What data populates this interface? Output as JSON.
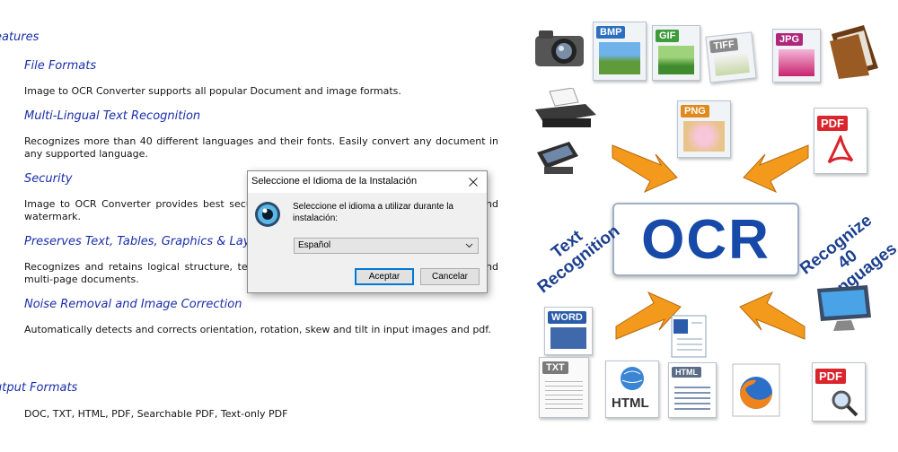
{
  "content": {
    "features_heading": "eatures",
    "sections": [
      {
        "title": "File Formats",
        "text": "Image to OCR Converter supports all popular Document and image formats."
      },
      {
        "title": "Multi-Lingual Text Recognition",
        "text": "Recognizes more than 40 different languages and their fonts. Easily convert any document in any supported language."
      },
      {
        "title": "Security",
        "text": "Image to OCR Converter provides best security features, including password protection and watermark."
      },
      {
        "title": "Preserves Text, Tables, Graphics & Layout",
        "text": "Recognizes and retains logical structure, text formatting, tables, and graphics in single and multi-page documents."
      },
      {
        "title": "Noise Removal and Image Correction",
        "text": "Automatically detects and corrects orientation, rotation, skew and tilt in input images and pdf."
      }
    ],
    "output_heading": "utput Formats",
    "output_text": "DOC, TXT, HTML, PDF, Searchable PDF, Text-only PDF"
  },
  "collage": {
    "center_text": "OCR",
    "left_label": "Text Recognition",
    "right_label": "Recognize 40 Languages",
    "tiles": {
      "bmp": "BMP",
      "gif": "GIF",
      "tiff": "TIFF",
      "jpg": "JPG",
      "png": "PNG",
      "pdf": "PDF",
      "word": "WORD",
      "txt": "TXT",
      "html": "HTML",
      "pdf2": "PDF"
    },
    "colors": {
      "ocr_blue": "#1649a8",
      "arrow_orange": "#f39a1d",
      "pdf_red": "#d9252b"
    }
  },
  "dialog": {
    "title": "Seleccione el Idioma de la Instalación",
    "prompt": "Seleccione el idioma a utilizar durante la instalación:",
    "selected_language": "Español",
    "ok_label": "Aceptar",
    "cancel_label": "Cancelar",
    "icons": {
      "app": "eye-icon",
      "close": "close-icon",
      "dropdown": "chevron-down-icon"
    }
  }
}
